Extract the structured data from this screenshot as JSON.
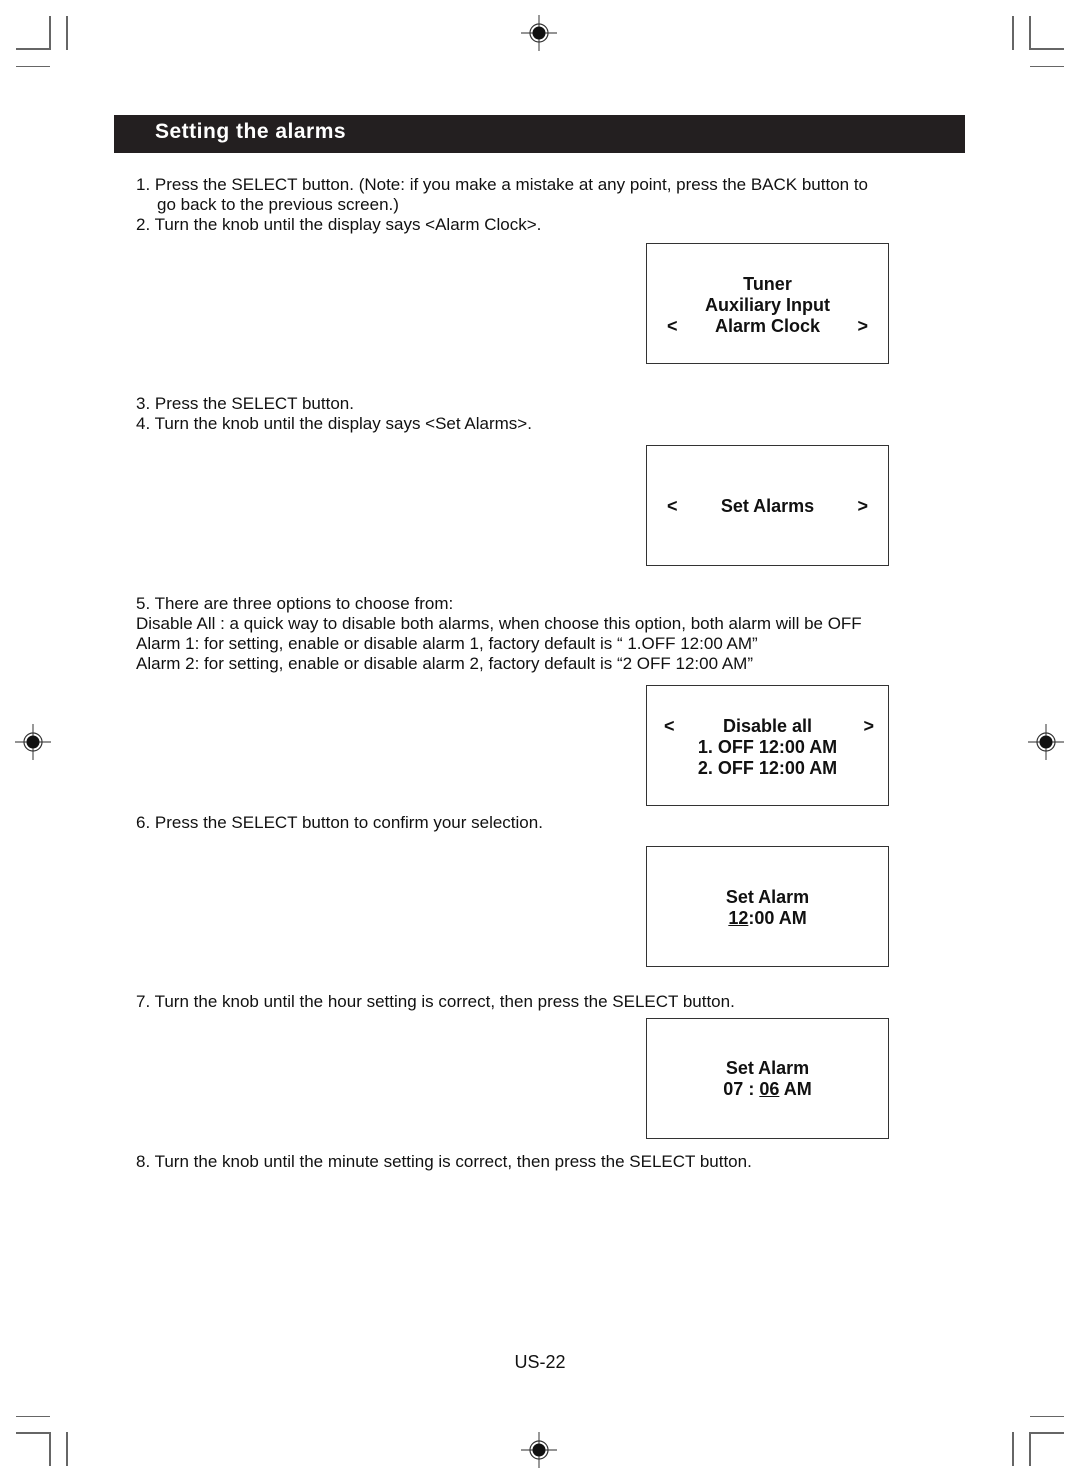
{
  "header": {
    "title": "Setting the alarms"
  },
  "steps": {
    "s1a": "1. Press the SELECT button. (Note: if you make a mistake at any point, press the BACK button to",
    "s1b": "go back to the previous screen.)",
    "s2": "2. Turn the knob until the display says <Alarm Clock>.",
    "s3": "3. Press the SELECT button.",
    "s4": "4. Turn the knob until the display says <Set Alarms>.",
    "s5": "5. There are three options to choose from:",
    "s5_disable": "Disable All : a quick way to disable both alarms, when choose this option, both alarm will be OFF",
    "s5_alarm1": "Alarm 1: for setting, enable or disable alarm 1, factory default is “ 1.OFF 12:00 AM”",
    "s5_alarm2": "Alarm 2: for setting, enable or disable alarm 2, factory default is “2 OFF 12:00 AM”",
    "s6": "6. Press the SELECT button to confirm your selection.",
    "s7": "7. Turn the knob until the hour setting is correct, then press the SELECT button.",
    "s8": "8. Turn the knob until the minute setting is correct, then press the SELECT button."
  },
  "displays": {
    "menu": {
      "line1": "Tuner",
      "line2": "Auxiliary Input",
      "line3": "Alarm Clock",
      "left": "<",
      "right": ">"
    },
    "set_alarms": {
      "line1": "Set Alarms",
      "left": "<",
      "right": ">"
    },
    "options": {
      "line1": "Disable all",
      "line2": "1. OFF 12:00 AM",
      "line3": "2. OFF 12:00 AM",
      "left": "<",
      "right": ">"
    },
    "hour": {
      "title": "Set Alarm",
      "hour": "12",
      "rest": ":00 AM"
    },
    "minute": {
      "title": "Set Alarm",
      "hour": "07 : ",
      "minute": "06",
      "rest": " AM"
    }
  },
  "footer": {
    "page": "US-22"
  }
}
